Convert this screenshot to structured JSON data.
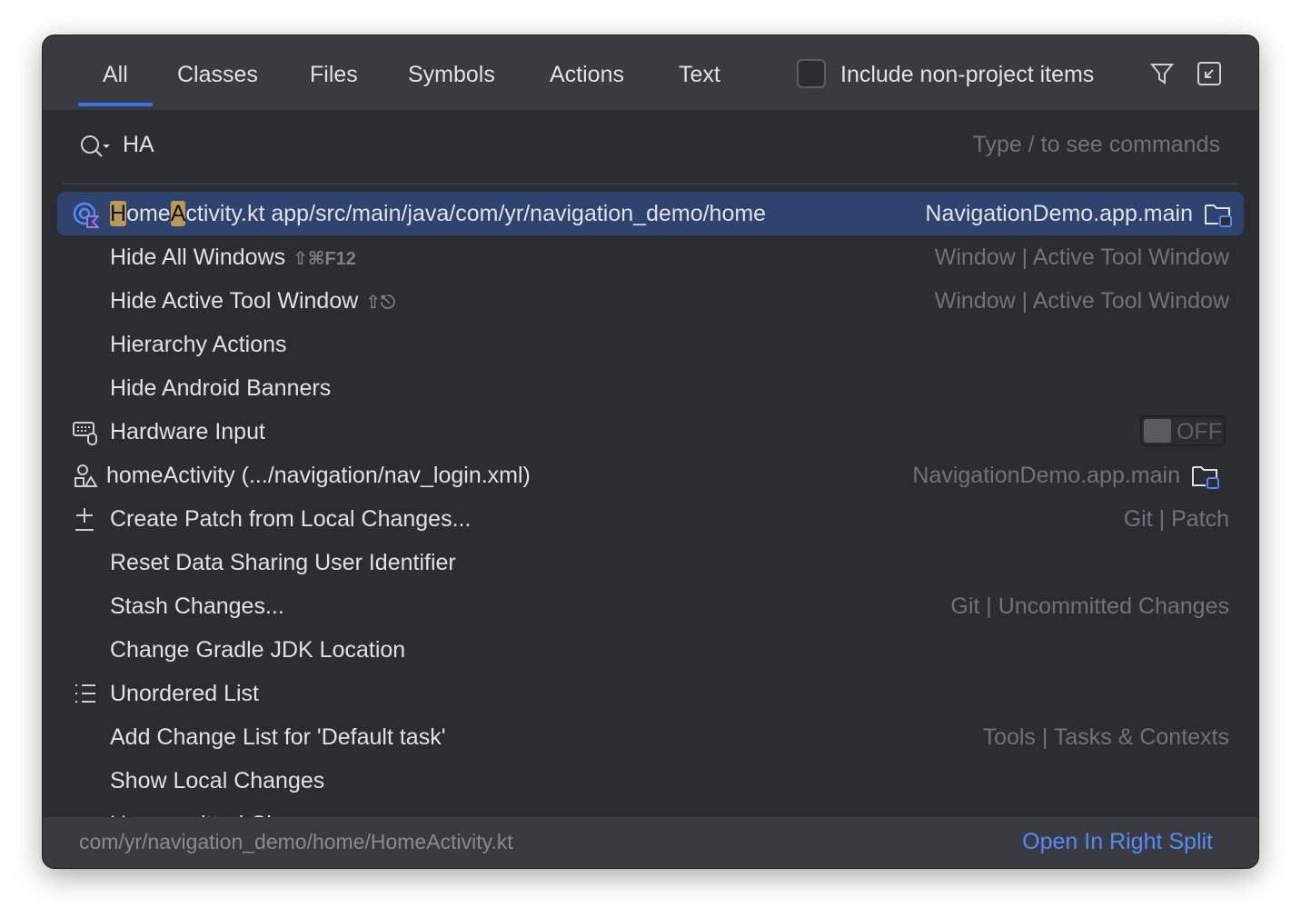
{
  "tabs": [
    {
      "label": "All",
      "active": true
    },
    {
      "label": "Classes"
    },
    {
      "label": "Files"
    },
    {
      "label": "Symbols"
    },
    {
      "label": "Actions"
    },
    {
      "label": "Text"
    }
  ],
  "include_non_project": {
    "label": "Include non-project items",
    "checked": false
  },
  "header_icons": [
    "filter-icon",
    "collapse-window-icon"
  ],
  "search": {
    "value": "HA",
    "hint": "Type / to see commands"
  },
  "results": [
    {
      "label": "HomeActivity.kt app/src/main/java/com/yr/navigation_demo/home",
      "highlight": [
        "H",
        "ome",
        "A",
        "ctivity.kt app/src/main/java/com/yr/navigation_demo/home"
      ],
      "right": "NavigationDemo.app.main",
      "icon": "kotlin-activity-icon",
      "selected": true
    },
    {
      "label": "Hide All Windows",
      "shortcut": "⇧⌘F12",
      "right": "Window | Active Tool Window"
    },
    {
      "label": "Hide Active Tool Window",
      "shortcut": "⇧⎋",
      "right": "Window | Active Tool Window"
    },
    {
      "label": "Hierarchy Actions"
    },
    {
      "label": "Hide Android Banners"
    },
    {
      "label": "Hardware Input",
      "icon": "keyboard-mouse-icon",
      "toggle": "OFF"
    },
    {
      "label": "homeActivity (.../navigation/nav_login.xml)",
      "icon": "shapes-icon",
      "right": "NavigationDemo.app.main"
    },
    {
      "label": "Create Patch from Local Changes...",
      "icon": "plus-minus-icon",
      "right": "Git | Patch"
    },
    {
      "label": "Reset Data Sharing User Identifier"
    },
    {
      "label": "Stash Changes...",
      "right": "Git | Uncommitted Changes"
    },
    {
      "label": "Change Gradle JDK Location"
    },
    {
      "label": "Unordered List",
      "icon": "list-icon"
    },
    {
      "label": "Add Change List for 'Default task'",
      "right": "Tools | Tasks & Contexts"
    },
    {
      "label": "Show Local Changes"
    },
    {
      "label": "Uncommitted Changes"
    }
  ],
  "footer": {
    "path": "com/yr/navigation_demo/home/HomeActivity.kt",
    "action": "Open In Right Split"
  },
  "colors": {
    "accent": "#3574f0",
    "selection": "#2e436e",
    "match_highlight": "#b89a55",
    "link": "#548af7"
  }
}
